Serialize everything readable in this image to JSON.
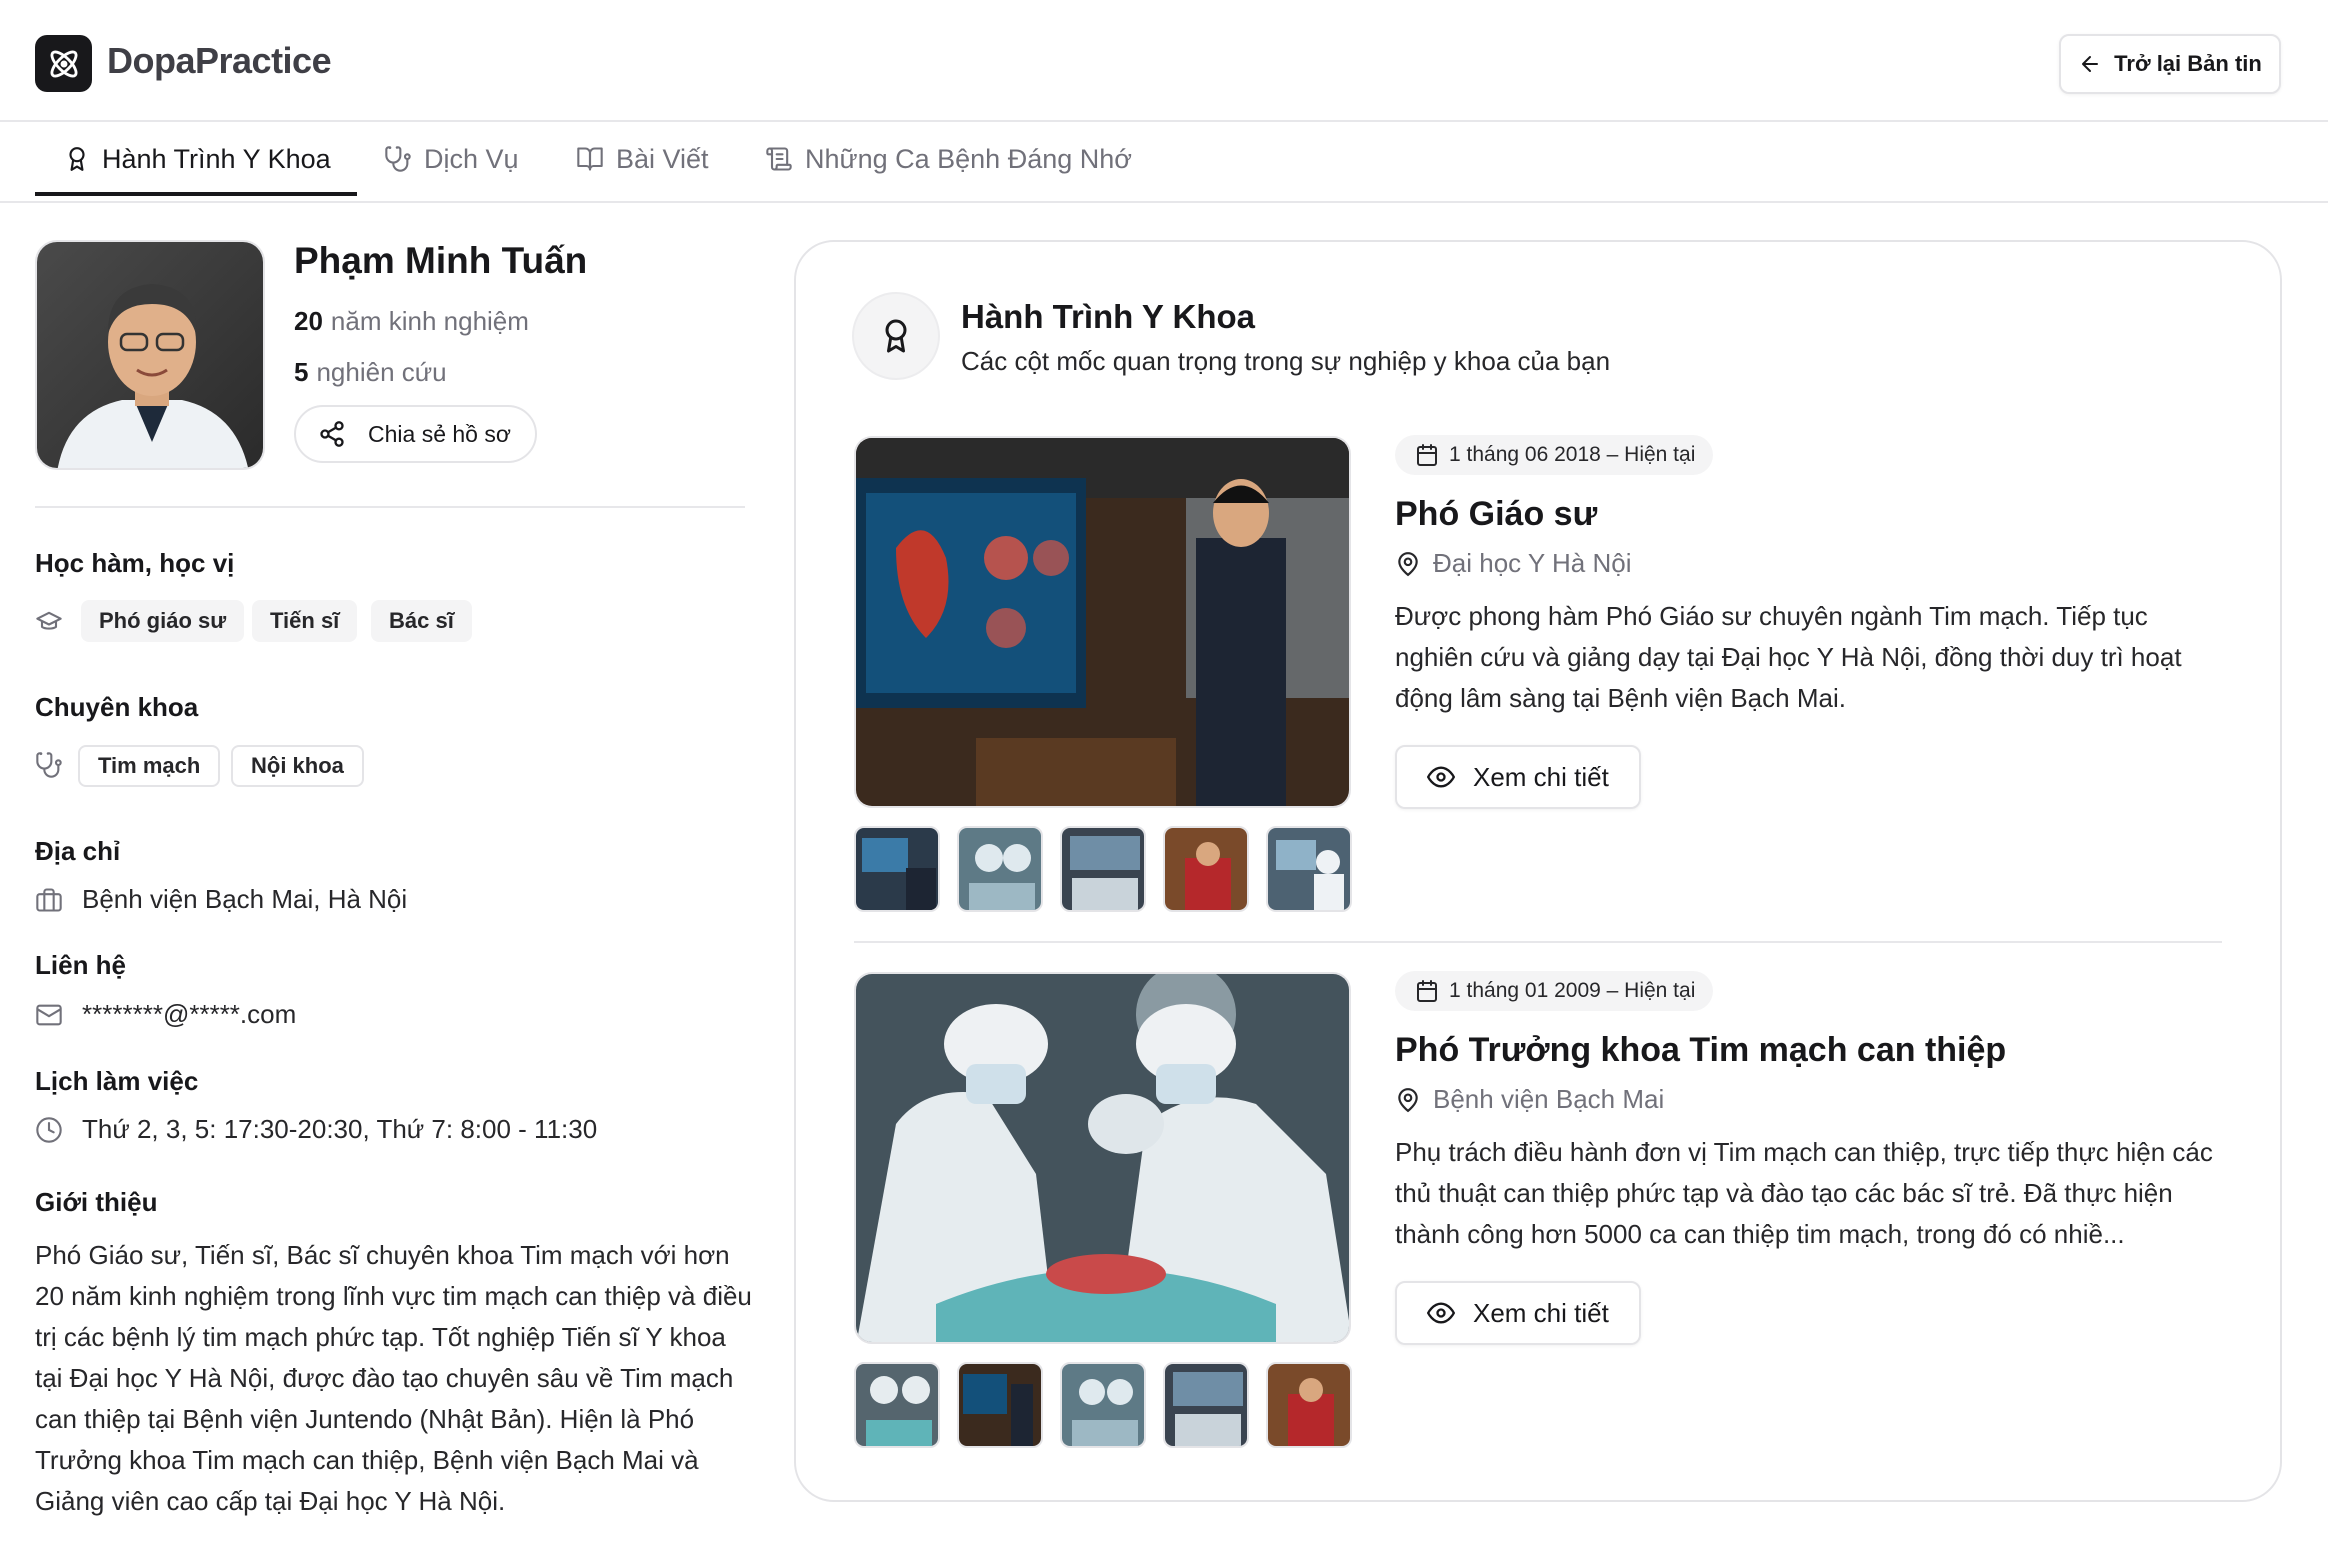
{
  "header": {
    "logo_icon": "atom-icon",
    "app_name": "DopaPractice",
    "back_button": "Trở lại Bản tin"
  },
  "tabs": [
    {
      "label": "Hành Trình Y Khoa",
      "icon": "award-icon",
      "active": true
    },
    {
      "label": "Dịch Vụ",
      "icon": "stethoscope-icon",
      "active": false
    },
    {
      "label": "Bài Viết",
      "icon": "book-open-icon",
      "active": false
    },
    {
      "label": "Những Ca Bệnh Đáng Nhớ",
      "icon": "scroll-icon",
      "active": false
    }
  ],
  "profile": {
    "name": "Phạm Minh Tuấn",
    "experience_value": "20",
    "experience_label": "năm kinh nghiệm",
    "research_value": "5",
    "research_label": "nghiên cứu",
    "share_button": "Chia sẻ hồ sơ"
  },
  "sections": {
    "degrees_title": "Học hàm, học vị",
    "degrees": [
      "Phó giáo sư",
      "Tiến sĩ",
      "Bác sĩ"
    ],
    "specialty_title": "Chuyên khoa",
    "specialties": [
      "Tim mạch",
      "Nội khoa"
    ],
    "address_title": "Địa chỉ",
    "address": "Bệnh viện Bạch Mai, Hà Nội",
    "contact_title": "Liên hệ",
    "contact": "********@*****.com",
    "schedule_title": "Lịch làm việc",
    "schedule": "Thứ 2, 3, 5: 17:30-20:30, Thứ 7: 8:00 - 11:30",
    "intro_title": "Giới thiệu",
    "intro": "Phó Giáo sư, Tiến sĩ, Bác sĩ chuyên khoa Tim mạch với hơn 20 năm kinh nghiệm trong lĩnh vực tim mạch can thiệp và điều trị các bệnh lý tim mạch phức tạp. Tốt nghiệp Tiến sĩ Y khoa tại Đại học Y Hà Nội, được đào tạo chuyên sâu về Tim mạch can thiệp tại Bệnh viện Juntendo (Nhật Bản). Hiện là Phó Trưởng khoa Tim mạch can thiệp, Bệnh viện Bạch Mai và Giảng viên cao cấp tại Đại học Y Hà Nội."
  },
  "journey": {
    "title": "Hành Trình Y Khoa",
    "subtitle": "Các cột mốc quan trọng trong sự nghiệp y khoa của bạn",
    "entries": [
      {
        "date": "1 tháng 06 2018 – Hiện tại",
        "role": "Phó Giáo sư",
        "place": "Đại học Y Hà Nội",
        "description": "Được phong hàm Phó Giáo sư chuyên ngành Tim mạch. Tiếp tục nghiên cứu và giảng dạy tại Đại học Y Hà Nội, đồng thời duy trì hoạt động lâm sàng tại Bệnh viện Bạch Mai.",
        "button": "Xem chi tiết"
      },
      {
        "date": "1 tháng 01 2009 – Hiện tại",
        "role": "Phó Trưởng khoa Tim mạch can thiệp",
        "place": "Bệnh viện Bạch Mai",
        "description": "Phụ trách điều hành đơn vị Tim mạch can thiệp, trực tiếp thực hiện các thủ thuật can thiệp phức tạp và đào tạo các bác sĩ trẻ. Đã thực hiện thành công hơn 5000 ca can thiệp tim mạch, trong đó có nhiề...",
        "button": "Xem chi tiết"
      }
    ]
  }
}
